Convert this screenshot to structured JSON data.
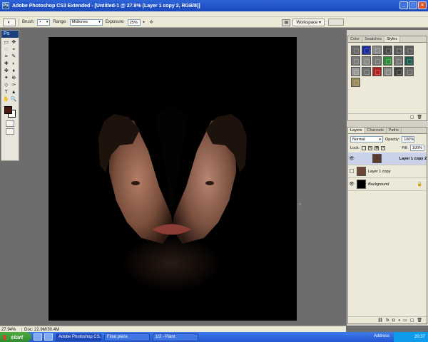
{
  "window": {
    "title": "Adobe Photoshop CS3 Extended - [Untitled-1 @ 27.9% (Layer 1 copy 2, RGB/8)]",
    "icon": "Ps"
  },
  "options": {
    "brush_label": "Brush:",
    "range_label": "Range:",
    "range_value": "Midtones",
    "exposure_label": "Exposure:",
    "exposure_value": "25%",
    "workspace_label": "Workspace ▾"
  },
  "toolbox": {
    "logo": "Ps",
    "tools": [
      "▭",
      "✥",
      "◌",
      "⌖",
      "⌗",
      "✎",
      "✚",
      "◐",
      "✤",
      "⬧",
      "✦",
      "⊕",
      "◇",
      "✑",
      "T",
      "▲",
      "✋",
      "🔍"
    ],
    "foreground_color": "#4b1812",
    "background_color": "#ffffff"
  },
  "status": {
    "zoom": "27.94%",
    "doc": "Doc: 22.9M/30.4M"
  },
  "styles_panel": {
    "tabs": [
      "Color",
      "Swatches",
      "Styles"
    ],
    "active_tab": "Styles",
    "swatches": [
      "#6a6a6a",
      "#1a2a9a",
      "#8a8a8a",
      "#4a4a4a",
      "#5a5a5a",
      "#5b5b5b",
      "#7a7a7a",
      "#888888",
      "#777777",
      "#2e8b3a",
      "#777777",
      "#1e5a4a",
      "#999999",
      "#707070",
      "#b01e1e",
      "#888888",
      "#3c3c3c",
      "#6a6a6a",
      "#9a8a5a"
    ]
  },
  "layers_panel": {
    "tabs": [
      "Layers",
      "Channels",
      "Paths"
    ],
    "active_tab": "Layers",
    "blend_mode": "Normal",
    "opacity_label": "Opacity:",
    "opacity_value": "100%",
    "lock_label": "Lock:",
    "fill_label": "Fill:",
    "fill_value": "100%",
    "layers": [
      {
        "name": "Layer 1 copy 2",
        "visible": true,
        "selected": true
      },
      {
        "name": "Layer 1 copy",
        "visible": false,
        "selected": false
      },
      {
        "name": "Background",
        "visible": true,
        "selected": false,
        "locked": true
      }
    ]
  },
  "taskbar": {
    "start": "start",
    "tasks": [
      "Adobe Photoshop CS...",
      "Final piece",
      "1/2 - Paint"
    ],
    "active_task": 0,
    "address_label": "Address",
    "clock": "20:37"
  }
}
